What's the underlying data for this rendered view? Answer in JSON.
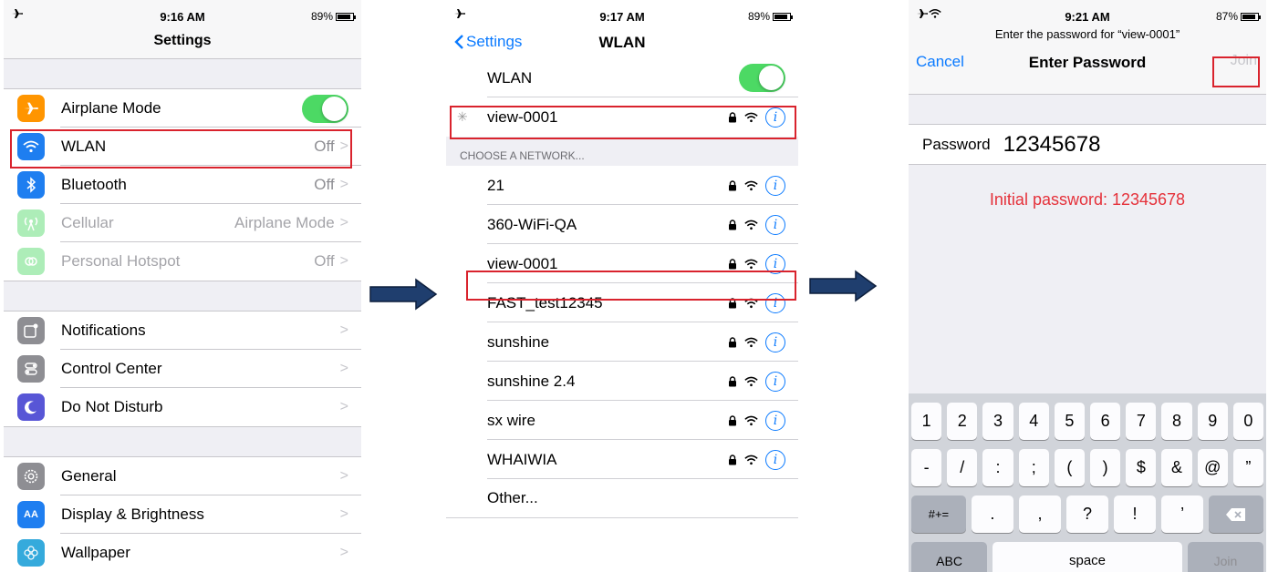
{
  "colors": {
    "accent": "#0a7aff",
    "toggle_on": "#4cd964",
    "highlight": "#d9232d",
    "hint": "#e5313a",
    "arrow": "#1f3e6e"
  },
  "screen1": {
    "status": {
      "time": "9:16 AM",
      "battery": "89%",
      "battery_level": 0.89
    },
    "title": "Settings",
    "group1": [
      {
        "label": "Airplane Mode",
        "icon": "airplane-icon",
        "color": "#ff9500",
        "toggle": true
      },
      {
        "label": "WLAN",
        "value": "Off",
        "icon": "wifi-icon",
        "color": "#1e7ef0"
      },
      {
        "label": "Bluetooth",
        "value": "Off",
        "icon": "bluetooth-icon",
        "color": "#1e7ef0"
      },
      {
        "label": "Cellular",
        "value": "Airplane Mode",
        "icon": "antenna-icon",
        "color": "#4cd964"
      },
      {
        "label": "Personal Hotspot",
        "value": "Off",
        "icon": "hotspot-icon",
        "color": "#4cd964"
      }
    ],
    "group2": [
      {
        "label": "Notifications",
        "icon": "notifications-icon",
        "color": "#8e8e93"
      },
      {
        "label": "Control Center",
        "icon": "switches-icon",
        "color": "#8e8e93"
      },
      {
        "label": "Do Not Disturb",
        "icon": "moon-icon",
        "color": "#5856d6"
      }
    ],
    "group3": [
      {
        "label": "General",
        "icon": "gear-icon",
        "color": "#8e8e93"
      },
      {
        "label": "Display & Brightness",
        "icon": "text-size-icon",
        "color": "#1e7ef0",
        "icon_text": "AA"
      },
      {
        "label": "Wallpaper",
        "icon": "flower-icon",
        "color": "#35aadc"
      }
    ]
  },
  "screen2": {
    "status": {
      "time": "9:17 AM",
      "battery": "89%",
      "battery_level": 0.89
    },
    "back": "Settings",
    "title": "WLAN",
    "wlan_label": "WLAN",
    "wlan_on": true,
    "connecting": "view-0001",
    "section": "CHOOSE A NETWORK...",
    "networks": [
      "21",
      "360-WiFi-QA",
      "view-0001",
      "FAST_test12345",
      "sunshine",
      "sunshine 2.4",
      "sx wire",
      "WHAIWIA"
    ],
    "other": "Other..."
  },
  "screen3": {
    "status": {
      "time": "9:21 AM",
      "battery": "87%",
      "battery_level": 0.87
    },
    "prompt": "Enter the password for “view-0001”",
    "cancel": "Cancel",
    "title": "Enter Password",
    "join": "Join",
    "password_label": "Password",
    "password_value": "12345678",
    "hint": "Initial password: 12345678",
    "keys_row1": [
      "1",
      "2",
      "3",
      "4",
      "5",
      "6",
      "7",
      "8",
      "9",
      "0"
    ],
    "keys_row2": [
      "-",
      "/",
      ":",
      ";",
      "(",
      ")",
      "$",
      "&",
      "@",
      "”"
    ],
    "keys_row3": [
      "#+=",
      ".",
      ",",
      "?",
      "!",
      "’"
    ],
    "abc": "ABC",
    "space": "space",
    "join_key": "Join"
  }
}
